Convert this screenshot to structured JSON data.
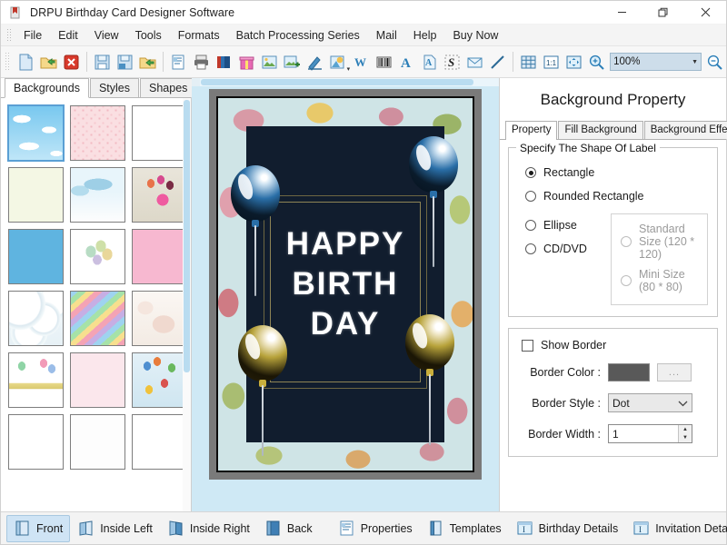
{
  "window": {
    "title": "DRPU Birthday Card Designer Software",
    "app_icon": "app-icon",
    "minimize": "–",
    "restore": "❐",
    "close": "✕"
  },
  "menu": {
    "items": [
      {
        "label": "File"
      },
      {
        "label": "Edit"
      },
      {
        "label": "View"
      },
      {
        "label": "Tools"
      },
      {
        "label": "Formats"
      },
      {
        "label": "Batch Processing Series"
      },
      {
        "label": "Mail"
      },
      {
        "label": "Help"
      },
      {
        "label": "Buy Now"
      }
    ]
  },
  "toolbar": {
    "zoom_value": "100%",
    "buttons": [
      {
        "name": "new-document-icon"
      },
      {
        "name": "open-folder-icon"
      },
      {
        "name": "close-document-icon"
      },
      {
        "name": "save-icon"
      },
      {
        "name": "save-as-icon"
      },
      {
        "name": "import-folder-icon"
      },
      {
        "name": "print-preview-icon"
      },
      {
        "name": "print-icon"
      },
      {
        "name": "card-stack-icon"
      },
      {
        "name": "gift-icon"
      },
      {
        "name": "insert-image-icon"
      },
      {
        "name": "add-image-icon"
      },
      {
        "name": "pen-icon"
      },
      {
        "name": "shape-picture-icon"
      },
      {
        "name": "watermark-icon"
      },
      {
        "name": "barcode-icon"
      },
      {
        "name": "text-icon"
      },
      {
        "name": "text-art-icon"
      },
      {
        "name": "signature-icon"
      },
      {
        "name": "envelope-icon"
      },
      {
        "name": "line-icon"
      },
      {
        "name": "grid-icon"
      },
      {
        "name": "actual-size-icon"
      },
      {
        "name": "fit-to-window-icon"
      },
      {
        "name": "zoom-in-icon"
      },
      {
        "name": "zoom-out-icon"
      }
    ]
  },
  "left_panel": {
    "tabs": [
      {
        "label": "Backgrounds",
        "active": true
      },
      {
        "label": "Styles",
        "active": false
      },
      {
        "label": "Shapes",
        "active": false
      }
    ],
    "thumbnails": [
      {
        "name": "background-sky-clouds",
        "art": "t-sky"
      },
      {
        "name": "background-pink-texture",
        "art": "t-pink"
      },
      {
        "name": "background-butterflies",
        "art": "t-butterfly"
      },
      {
        "name": "background-daisies",
        "art": "t-daisy"
      },
      {
        "name": "background-winter-scene",
        "art": "t-winter"
      },
      {
        "name": "background-balloons-beige",
        "art": "t-balloon1"
      },
      {
        "name": "background-blue-stars",
        "art": "t-stars"
      },
      {
        "name": "background-white-balloons",
        "art": "t-wbal"
      },
      {
        "name": "background-pink-gifts",
        "art": "t-pinkgift"
      },
      {
        "name": "background-bubbles",
        "art": "t-bubble"
      },
      {
        "name": "background-rainbow-stripes",
        "art": "t-rainbow"
      },
      {
        "name": "background-cream-blur",
        "art": "t-cream"
      },
      {
        "name": "background-happy-birthday",
        "art": "t-hbd"
      },
      {
        "name": "background-pink-hearts-stripes",
        "art": "t-stripe"
      },
      {
        "name": "background-colored-balloons",
        "art": "t-ball2"
      },
      {
        "name": "background-pastel-hearts",
        "art": "t-hearts1"
      },
      {
        "name": "background-balloon-bunches",
        "art": "t-grape"
      },
      {
        "name": "background-red-hearts",
        "art": "t-redheart"
      }
    ]
  },
  "card": {
    "text_lines": [
      "HAPPY",
      "BIRTH",
      "DAY"
    ],
    "background_color": "#111d2e",
    "frame_color": "#cfe4e6",
    "balloons": [
      {
        "name": "balloon-blue-left",
        "color": "#2a6fa8"
      },
      {
        "name": "balloon-blue-right",
        "color": "#2a6fa8"
      },
      {
        "name": "balloon-gold-left",
        "color": "#b7a23a"
      },
      {
        "name": "balloon-gold-right",
        "color": "#b7a23a"
      }
    ]
  },
  "right_panel": {
    "title": "Background Property",
    "tabs": [
      {
        "label": "Property",
        "active": true
      },
      {
        "label": "Fill Background",
        "active": false
      },
      {
        "label": "Background Effects",
        "active": false
      }
    ],
    "shape_group": {
      "legend": "Specify The Shape Of Label",
      "options": [
        {
          "label": "Rectangle",
          "selected": true,
          "disabled": false
        },
        {
          "label": "Rounded Rectangle",
          "selected": false,
          "disabled": false
        },
        {
          "label": "Ellipse",
          "selected": false,
          "disabled": false
        },
        {
          "label": "CD/DVD",
          "selected": false,
          "disabled": false
        }
      ],
      "cd_options": [
        {
          "label": "Standard Size (120 * 120)",
          "selected": false,
          "disabled": true
        },
        {
          "label": "Mini Size (80 * 80)",
          "selected": false,
          "disabled": true
        }
      ]
    },
    "border_group": {
      "show_border_label": "Show Border",
      "show_border_checked": false,
      "border_color_label": "Border Color :",
      "border_color_value": "#595959",
      "browse_label": "...",
      "border_style_label": "Border Style :",
      "border_style_value": "Dot",
      "border_width_label": "Border Width :",
      "border_width_value": "1"
    }
  },
  "bottom_bar": {
    "items": [
      {
        "label": "Front",
        "icon": "card-front-icon",
        "active": true
      },
      {
        "label": "Inside Left",
        "icon": "card-inside-left-icon",
        "active": false
      },
      {
        "label": "Inside Right",
        "icon": "card-inside-right-icon",
        "active": false
      },
      {
        "label": "Back",
        "icon": "card-back-icon",
        "active": false
      },
      {
        "label": "Properties",
        "icon": "properties-icon",
        "active": false
      },
      {
        "label": "Templates",
        "icon": "templates-icon",
        "active": false
      },
      {
        "label": "Birthday Details",
        "icon": "birthday-details-icon",
        "active": false
      },
      {
        "label": "Invitation Details",
        "icon": "invitation-details-icon",
        "active": false
      }
    ]
  }
}
